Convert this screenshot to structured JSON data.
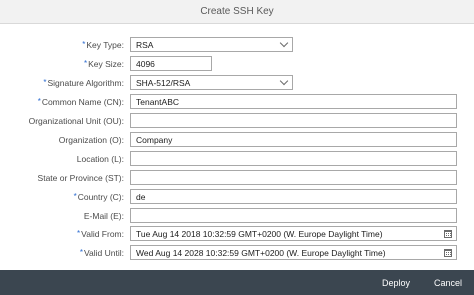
{
  "dialog": {
    "title": "Create SSH Key"
  },
  "form": {
    "required_marker": "*",
    "key_type": {
      "label": "Key Type:",
      "value": "RSA",
      "required": true
    },
    "key_size": {
      "label": "Key Size:",
      "value": "4096",
      "required": true
    },
    "signature_algorithm": {
      "label": "Signature Algorithm:",
      "value": "SHA-512/RSA",
      "required": true
    },
    "common_name": {
      "label": "Common Name (CN):",
      "value": "TenantABC",
      "required": true
    },
    "org_unit": {
      "label": "Organizational Unit (OU):",
      "value": "",
      "required": false
    },
    "organization": {
      "label": "Organization (O):",
      "value": "Company",
      "required": false
    },
    "location": {
      "label": "Location (L):",
      "value": "",
      "required": false
    },
    "state": {
      "label": "State or Province (ST):",
      "value": "",
      "required": false
    },
    "country": {
      "label": "Country (C):",
      "value": "de",
      "required": true
    },
    "email": {
      "label": "E-Mail (E):",
      "value": "",
      "required": false
    },
    "valid_from": {
      "label": "Valid From:",
      "value": "Tue Aug 14 2018 10:32:59 GMT+0200 (W. Europe Daylight Time)",
      "required": true
    },
    "valid_until": {
      "label": "Valid Until:",
      "value": "Wed Aug 14 2028 10:32:59 GMT+0200 (W. Europe Daylight Time)",
      "required": true
    }
  },
  "footer": {
    "deploy_label": "Deploy",
    "cancel_label": "Cancel"
  },
  "colors": {
    "footer_bg": "#3b4650",
    "required_marker": "#2b6bd1",
    "header_bg": "#f2f2f2"
  },
  "icons": {
    "dropdown": "chevron-down-icon",
    "date": "calendar-icon"
  }
}
